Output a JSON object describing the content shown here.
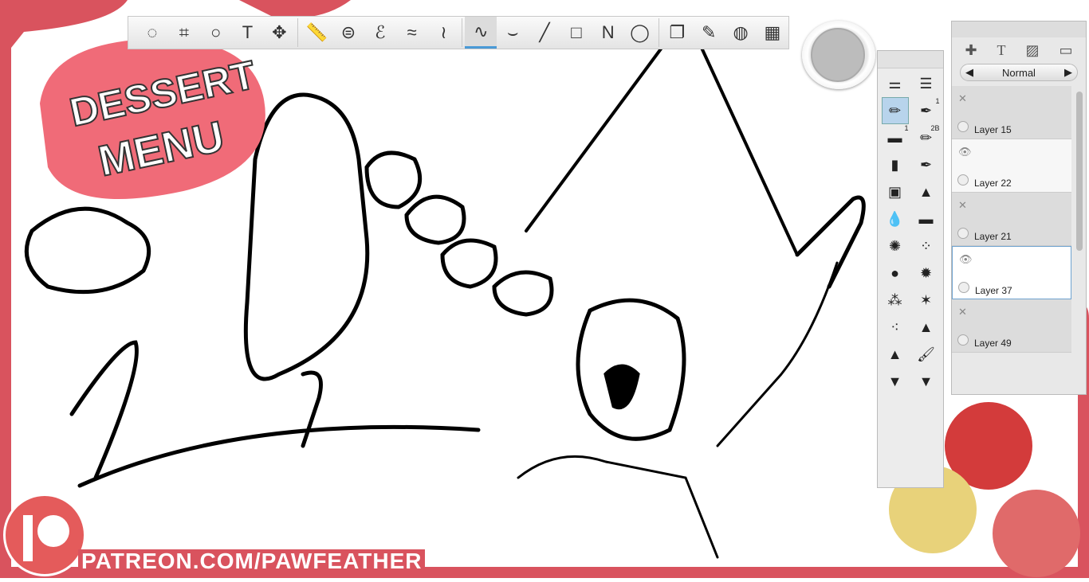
{
  "overlay": {
    "logo_line1": "DESSERT",
    "logo_line2": "MENU",
    "patreon_url": "PATREON.COM/PAWFEATHER",
    "accent": "#d9535e"
  },
  "toolbar": {
    "tools": [
      {
        "icon": "lasso-icon",
        "glyph": "◌"
      },
      {
        "icon": "crop-icon",
        "glyph": "⌗"
      },
      {
        "icon": "zoom-icon",
        "glyph": "○"
      },
      {
        "icon": "text-icon",
        "glyph": "T"
      },
      {
        "icon": "transform-icon",
        "glyph": "✥"
      },
      {
        "icon": "ruler-icon",
        "glyph": "📏"
      },
      {
        "icon": "ellipse-guide-icon",
        "glyph": "⊜"
      },
      {
        "icon": "french-curve-icon",
        "glyph": "ℰ"
      },
      {
        "icon": "symmetry-x-icon",
        "glyph": "≈"
      },
      {
        "icon": "symmetry-y-icon",
        "glyph": "≀"
      },
      {
        "icon": "freehand-stroke-icon",
        "glyph": "∿",
        "selected": true
      },
      {
        "icon": "curve-stroke-icon",
        "glyph": "⌣"
      },
      {
        "icon": "line-icon",
        "glyph": "╱"
      },
      {
        "icon": "rectangle-icon",
        "glyph": "□"
      },
      {
        "icon": "polyline-icon",
        "glyph": "Ν"
      },
      {
        "icon": "ellipse-icon",
        "glyph": "◯"
      },
      {
        "icon": "layers-icon",
        "glyph": "❐"
      },
      {
        "icon": "brush-library-icon",
        "glyph": "✎"
      },
      {
        "icon": "color-wheel-icon",
        "glyph": "◍"
      },
      {
        "icon": "copic-icon",
        "glyph": "▦"
      }
    ]
  },
  "brushes": {
    "cells": [
      {
        "icon": "brush-properties-icon",
        "glyph": "⚌"
      },
      {
        "icon": "brush-list-icon",
        "glyph": "☰"
      },
      {
        "icon": "pencil-brush-icon",
        "glyph": "✏",
        "selected": true
      },
      {
        "icon": "pen-brush-icon",
        "glyph": "✒",
        "badge": "1"
      },
      {
        "icon": "eraser-brush-icon",
        "glyph": "▬",
        "badge": "1"
      },
      {
        "icon": "pencil-2b-icon",
        "glyph": "✏",
        "badge": "2B"
      },
      {
        "icon": "airbrush-icon",
        "glyph": "▮"
      },
      {
        "icon": "ink-pen-icon",
        "glyph": "✒"
      },
      {
        "icon": "paint-bucket-icon",
        "glyph": "▣"
      },
      {
        "icon": "chisel-brush-icon",
        "glyph": "▲"
      },
      {
        "icon": "water-drop-icon",
        "glyph": "💧"
      },
      {
        "icon": "block-eraser-icon",
        "glyph": "▬"
      },
      {
        "icon": "splatter-brush-icon",
        "glyph": "✺"
      },
      {
        "icon": "dots-brush-icon",
        "glyph": "⁘"
      },
      {
        "icon": "blot-brush-icon",
        "glyph": "●"
      },
      {
        "icon": "splash-brush-icon",
        "glyph": "✹"
      },
      {
        "icon": "spatter-brush-icon",
        "glyph": "⁂"
      },
      {
        "icon": "ink-blot-icon",
        "glyph": "✶"
      },
      {
        "icon": "speckle-brush-icon",
        "glyph": "⁖"
      },
      {
        "icon": "marker-brush-icon",
        "glyph": "▲"
      },
      {
        "icon": "felt-tip-icon",
        "glyph": "▲"
      },
      {
        "icon": "paintbrush-icon",
        "glyph": "🖌"
      },
      {
        "icon": "flat-brush-icon",
        "glyph": "▼"
      },
      {
        "icon": "fan-brush-icon",
        "glyph": "▼"
      }
    ]
  },
  "layers": {
    "blend_mode": "Normal",
    "items": [
      {
        "name": "Layer 15",
        "visible": false
      },
      {
        "name": "Layer 22",
        "visible": true
      },
      {
        "name": "Layer 21",
        "visible": false
      },
      {
        "name": "Layer 37",
        "visible": true,
        "active": true
      },
      {
        "name": "Layer 49",
        "visible": false
      }
    ]
  }
}
